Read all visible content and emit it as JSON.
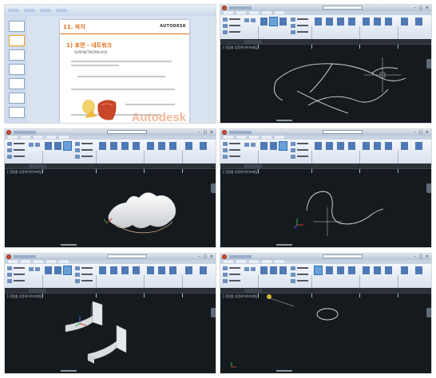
{
  "thumbnails": [
    {
      "id": 1,
      "app": "PowerPoint",
      "slide": {
        "chapter_title": "11. 파치",
        "brand": "AUTODESK",
        "section_heading": "1) 표면 - 네트워크",
        "subtitle": "SURFNETWORK(표면)",
        "watermark": "Autodesk"
      }
    },
    {
      "id": 2,
      "app": "AutoCAD",
      "scene": "wire-curves",
      "file_tab": "Drawing1*"
    },
    {
      "id": 3,
      "app": "AutoCAD",
      "scene": "network-surface",
      "file_tab": "Drawing1*"
    },
    {
      "id": 4,
      "app": "AutoCAD",
      "scene": "single-spline",
      "file_tab": "Drawing1*"
    },
    {
      "id": 5,
      "app": "AutoCAD",
      "scene": "corner-surfaces",
      "file_tab": "Drawing1*"
    },
    {
      "id": 6,
      "app": "AutoCAD",
      "scene": "circle-profile",
      "file_tab": "Drawing1*"
    }
  ],
  "viewport_label": "[-][맞춤 뷰][와이어프레임]",
  "colors": {
    "canvas": "#151a1f",
    "brand_orange": "#e0701a",
    "wire": "#d8dde3",
    "surface": "#eef0f2"
  }
}
